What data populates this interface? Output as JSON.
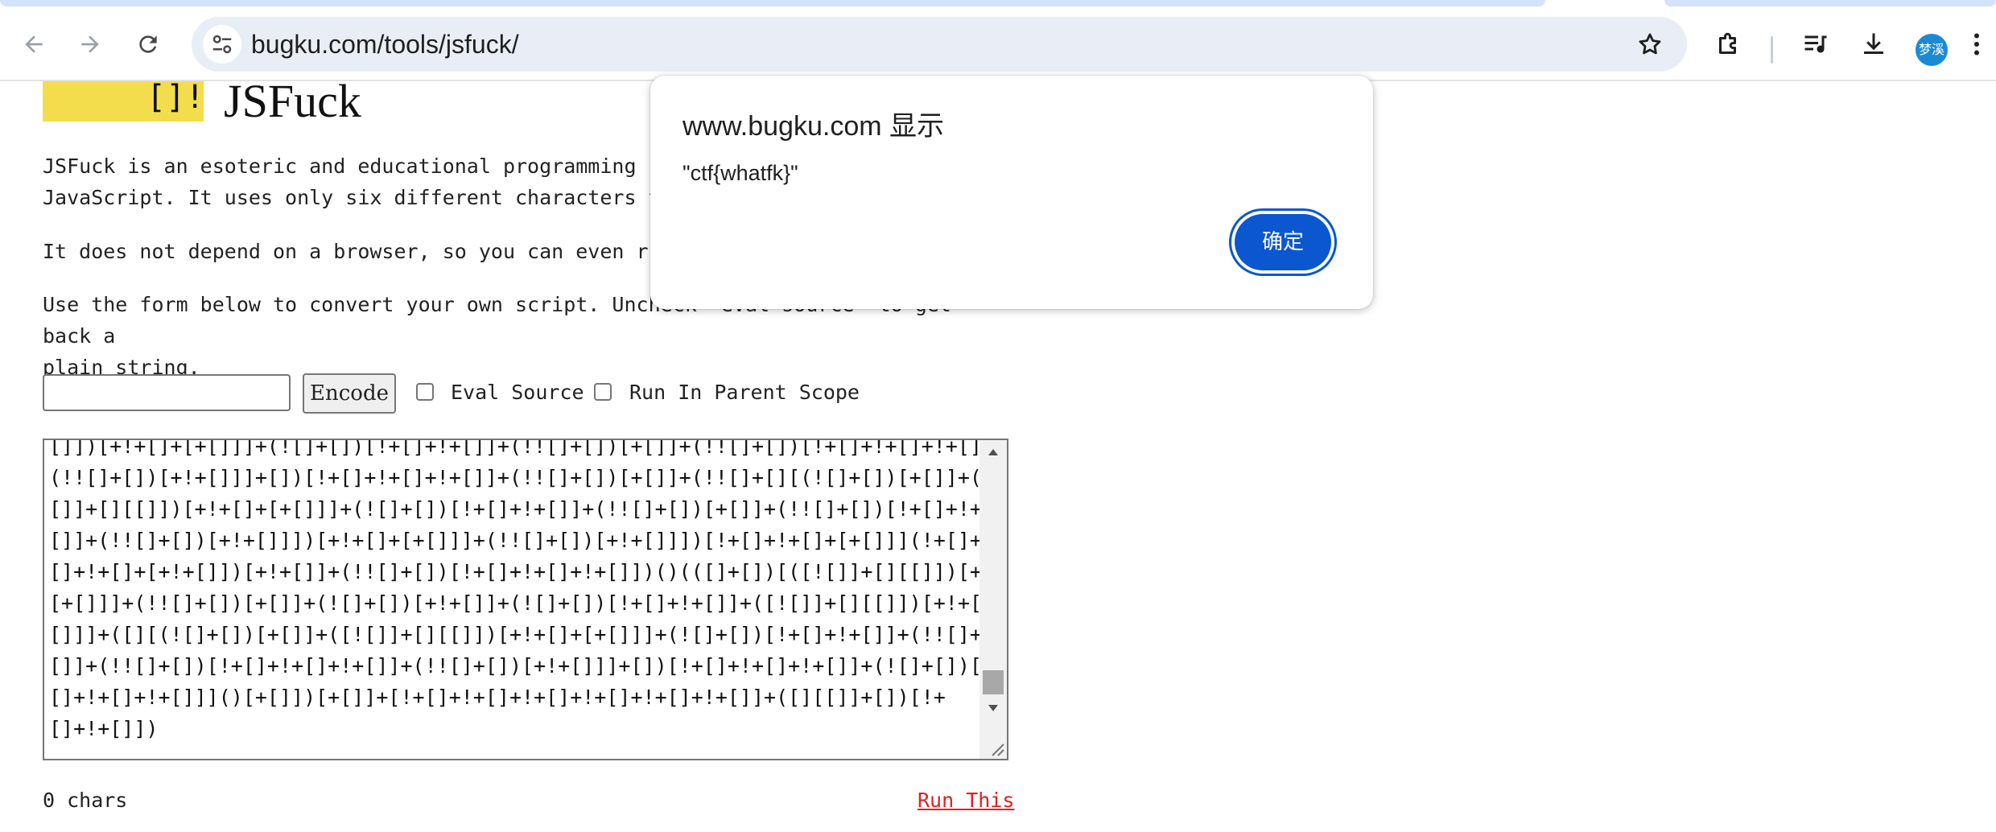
{
  "browser": {
    "url": "bugku.com/tools/jsfuck/",
    "profile_initials": "梦溪",
    "accent_color": "#0b57d0"
  },
  "page": {
    "logo_text": "[]!",
    "title": "JSFuck",
    "para1_line1": "JSFuck is an esoteric and educational programming styl",
    "para1_line2": "JavaScript. It uses only six different characters to w",
    "para2": "It does not depend on a browser, so you can even run i",
    "para3_line1": "Use the form below to convert your own script. Uncheck \"eval source\" to get back a",
    "para3_line2": "plain string.",
    "encode_label": "Encode",
    "eval_source_label": "Eval Source",
    "run_in_parent_label": "Run In Parent Scope",
    "output_lines": [
      "[]])[+!+[]+[+[]]]+(![]+[])[!+[]+!+[]]+(!![]+[])[+[]]+(!![]+[])[!+[]+!+[]+!+[]]+",
      "(!![]+[])[+!+[]]]+[])[!+[]+!+[]+!+[]]+(!![]+[])[+[]]+(!![]+[][(![]+[])[+[]]+([!",
      "[]]+[][[]])[+!+[]+[+[]]]+(![]+[])[!+[]+!+[]]+(!![]+[])[+[]]+(!![]+[])[!+[]+!+[]+!+",
      "[]]+(!![]+[])[+!+[]]])[+!+[]+[+[]]]+(!![]+[])[+!+[]]])[!+[]+!+[]+[+[]]](!+[]+!+",
      "[]+!+[]+[+!+[]])[+!+[]]+(!![]+[])[!+[]+!+[]+!+[]])()(([]+[])[([![]]+[][[]])[+!+[]+",
      "[+[]]]+(!![]+[])[+[]]+(![]+[])[+!+[]]+(![]+[])[!+[]+!+[]]+([![]]+[][[]])[+!+[]+[+",
      "[]]]+([][(![]+[])[+[]]+([![]]+[][[]])[+!+[]+[+[]]]+(![]+[])[!+[]+!+[]]+(!![]+[])[+",
      "[]]+(!![]+[])[!+[]+!+[]+!+[]]+(!![]+[])[+!+[]]]+[])[!+[]+!+[]+!+[]]+(![]+[])[!+",
      "[]+!+[]+!+[]]]()[+[]])[+[]]+[!+[]+!+[]+!+[]+!+[]+!+[]+!+[]]+([][[]]+[])[!+",
      "[]+!+[]])"
    ],
    "chars_count": "0 chars",
    "run_this_label": "Run This"
  },
  "dialog": {
    "title": "www.bugku.com 显示",
    "message": "\"ctf{whatfk}\"",
    "ok_label": "确定"
  }
}
